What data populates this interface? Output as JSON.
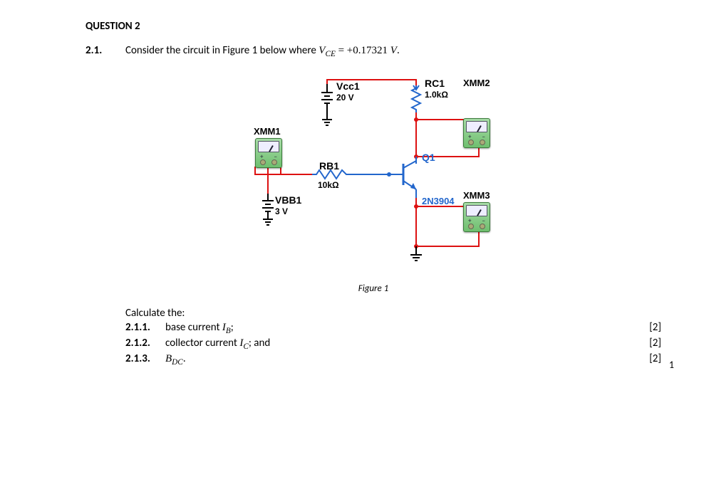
{
  "question": {
    "title": "QUESTION 2",
    "sub_number": "2.1.",
    "prompt_prefix": "Consider the circuit in Figure 1 below where ",
    "vce_var": "V",
    "vce_sub": "CE",
    "vce_eq": " = +0.17321 ",
    "vce_unit": "V",
    "prompt_suffix": "."
  },
  "figure": {
    "caption": "Figure 1",
    "components": {
      "vcc1": {
        "name": "Vcc1",
        "value": "20 V"
      },
      "vbb1": {
        "name": "VBB1",
        "value": "3 V"
      },
      "rb1": {
        "name": "RB1",
        "value": "10kΩ"
      },
      "rc1": {
        "name": "RC1",
        "value": "1.0kΩ"
      },
      "q1": {
        "name": "Q1",
        "part": "2N3904"
      }
    },
    "meters": {
      "xmm1": "XMM1",
      "xmm2": "XMM2",
      "xmm3": "XMM3"
    }
  },
  "calc": {
    "heading": "Calculate the:",
    "items": [
      {
        "num": "2.1.1.",
        "text_pre": "base current ",
        "var": "I",
        "sub": "B",
        "text_post": ";",
        "marks": "[2]"
      },
      {
        "num": "2.1.2.",
        "text_pre": "collector current ",
        "var": "I",
        "sub": "C",
        "text_post": "; and",
        "marks": "[2]"
      },
      {
        "num": "2.1.3.",
        "text_pre": "",
        "var": "B",
        "sub": "DC",
        "text_post": ".",
        "marks": "[2]"
      }
    ]
  },
  "page_number": "1"
}
